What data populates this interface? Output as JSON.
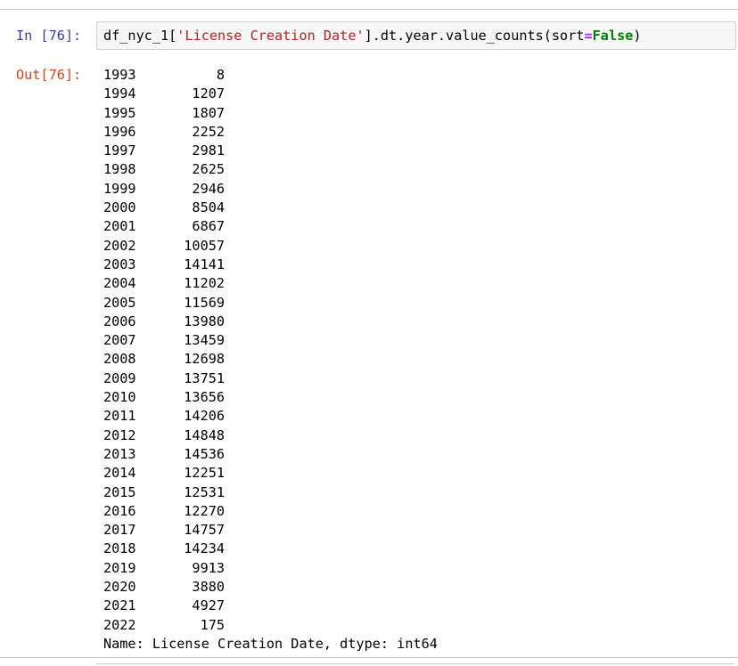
{
  "cell": {
    "in_prompt": "In [76]:",
    "out_prompt": "Out[76]:",
    "code_tokens": [
      {
        "text": "df_nyc_1[",
        "cls": ""
      },
      {
        "text": "'License Creation Date'",
        "cls": "tok-str"
      },
      {
        "text": "].dt.year.value_counts(sort",
        "cls": ""
      },
      {
        "text": "=",
        "cls": "tok-op"
      },
      {
        "text": "False",
        "cls": "tok-kw"
      },
      {
        "text": ")",
        "cls": ""
      }
    ],
    "output_rows": [
      {
        "year": "1993",
        "count": "8"
      },
      {
        "year": "1994",
        "count": "1207"
      },
      {
        "year": "1995",
        "count": "1807"
      },
      {
        "year": "1996",
        "count": "2252"
      },
      {
        "year": "1997",
        "count": "2981"
      },
      {
        "year": "1998",
        "count": "2625"
      },
      {
        "year": "1999",
        "count": "2946"
      },
      {
        "year": "2000",
        "count": "8504"
      },
      {
        "year": "2001",
        "count": "6867"
      },
      {
        "year": "2002",
        "count": "10057"
      },
      {
        "year": "2003",
        "count": "14141"
      },
      {
        "year": "2004",
        "count": "11202"
      },
      {
        "year": "2005",
        "count": "11569"
      },
      {
        "year": "2006",
        "count": "13980"
      },
      {
        "year": "2007",
        "count": "13459"
      },
      {
        "year": "2008",
        "count": "12698"
      },
      {
        "year": "2009",
        "count": "13751"
      },
      {
        "year": "2010",
        "count": "13656"
      },
      {
        "year": "2011",
        "count": "14206"
      },
      {
        "year": "2012",
        "count": "14848"
      },
      {
        "year": "2013",
        "count": "14536"
      },
      {
        "year": "2014",
        "count": "12251"
      },
      {
        "year": "2015",
        "count": "12531"
      },
      {
        "year": "2016",
        "count": "12270"
      },
      {
        "year": "2017",
        "count": "14757"
      },
      {
        "year": "2018",
        "count": "14234"
      },
      {
        "year": "2019",
        "count": "9913"
      },
      {
        "year": "2020",
        "count": "3880"
      },
      {
        "year": "2021",
        "count": "4927"
      },
      {
        "year": "2022",
        "count": "175"
      }
    ],
    "footer": "Name: License Creation Date, dtype: int64"
  }
}
